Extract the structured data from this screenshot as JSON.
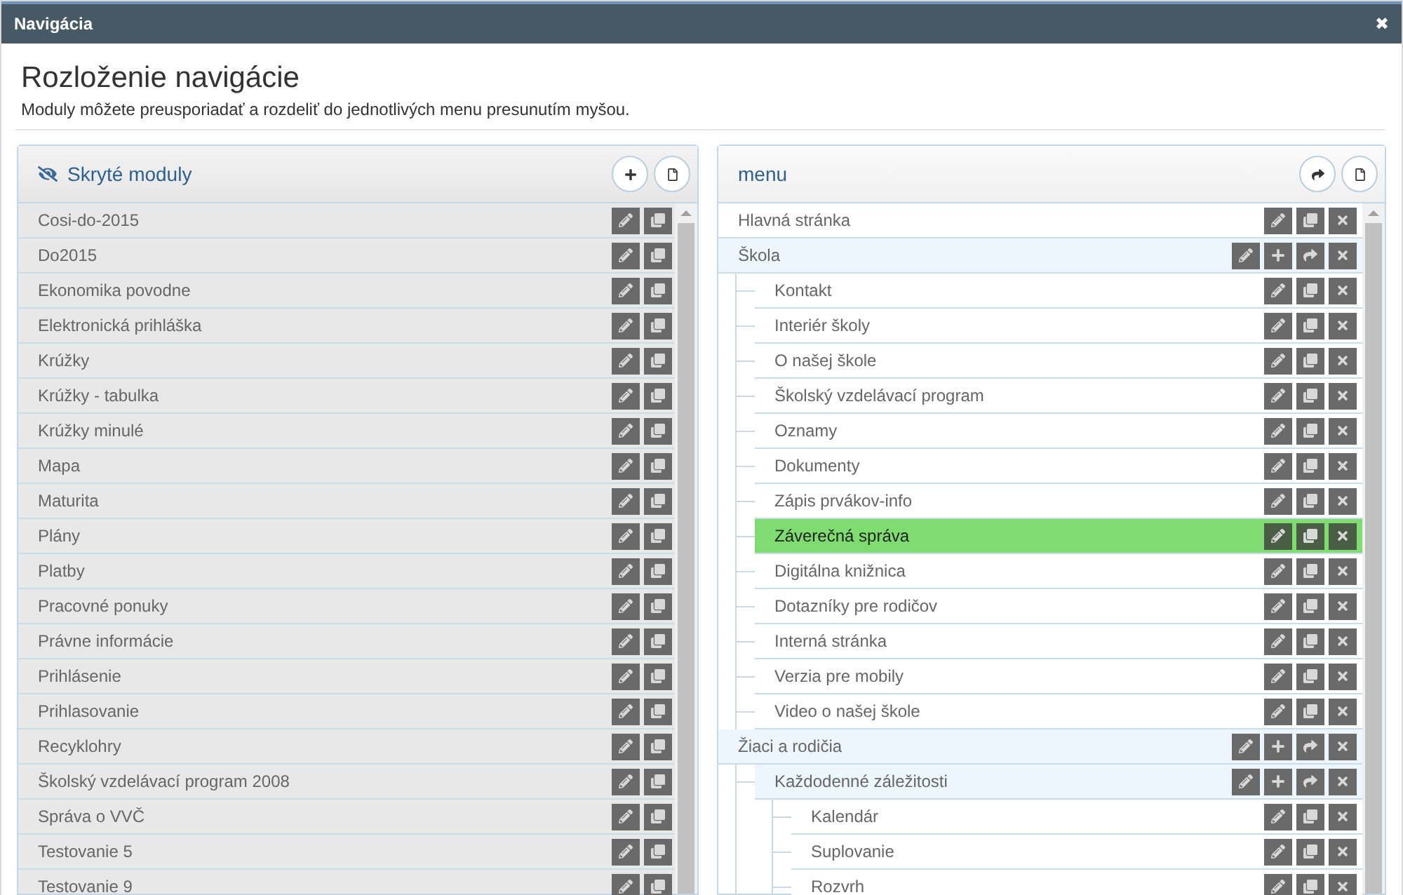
{
  "window": {
    "title": "Navigácia",
    "close": "✖"
  },
  "heading": "Rozloženie navigácie",
  "description": "Moduly môžete preusporiadať a rozdeliť do jednotlivých menu presunutím myšou.",
  "hidden_modules": {
    "title": "Skryté moduly",
    "items": [
      "Cosi-do-2015",
      "Do2015",
      "Ekonomika povodne",
      "Elektronická prihláška",
      "Krúžky",
      "Krúžky - tabulka",
      "Krúžky minulé",
      "Mapa",
      "Maturita",
      "Plány",
      "Platby",
      "Pracovné ponuky",
      "Právne informácie",
      "Prihlásenie",
      "Prihlasovanie",
      "Recyklohry",
      "Školský vzdelávací program 2008",
      "Správa o VVČ",
      "Testovanie 5",
      "Testovanie 9"
    ]
  },
  "menu": {
    "title": "menu",
    "items": [
      {
        "label": "Hlavná stránka",
        "kind": "page",
        "selected": false
      },
      {
        "label": "Škola",
        "kind": "group",
        "selected": false,
        "children": [
          {
            "label": "Kontakt",
            "kind": "page",
            "selected": false
          },
          {
            "label": "Interiér školy",
            "kind": "page",
            "selected": false
          },
          {
            "label": "O našej škole",
            "kind": "page",
            "selected": false
          },
          {
            "label": "Školský vzdelávací program",
            "kind": "page",
            "selected": false
          },
          {
            "label": "Oznamy",
            "kind": "page",
            "selected": false
          },
          {
            "label": "Dokumenty",
            "kind": "page",
            "selected": false
          },
          {
            "label": "Zápis prvákov-info",
            "kind": "page",
            "selected": false
          },
          {
            "label": "Záverečná správa",
            "kind": "page",
            "selected": true
          },
          {
            "label": "Digitálna knižnica",
            "kind": "page",
            "selected": false
          },
          {
            "label": "Dotazníky pre rodičov",
            "kind": "page",
            "selected": false
          },
          {
            "label": "Interná stránka",
            "kind": "page",
            "selected": false
          },
          {
            "label": "Verzia pre mobily",
            "kind": "page",
            "selected": false
          },
          {
            "label": "Video o našej škole",
            "kind": "page",
            "selected": false
          }
        ]
      },
      {
        "label": "Žiaci a rodičia",
        "kind": "group",
        "selected": false,
        "children": [
          {
            "label": "Každodenné záležitosti",
            "kind": "group",
            "selected": false,
            "children": [
              {
                "label": "Kalendár",
                "kind": "page",
                "selected": false
              },
              {
                "label": "Suplovanie",
                "kind": "page",
                "selected": false
              },
              {
                "label": "Rozvrh",
                "kind": "page",
                "selected": false
              }
            ]
          }
        ]
      }
    ]
  }
}
